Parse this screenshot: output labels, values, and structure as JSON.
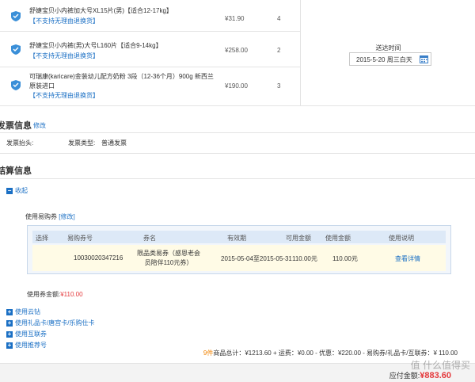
{
  "products": [
    {
      "name": "舒婕宝贝小内裤加大号XL15片(男)【适合12-17kg】",
      "tag": "【不支持无理由退换货】",
      "price": "¥31.90",
      "qty": "4"
    },
    {
      "name": "舒婕宝贝小内裤(男)大号L160片【适合9-14kg】",
      "tag": "【不支持无理由退换货】",
      "price": "¥258.00",
      "qty": "2"
    },
    {
      "name": "可瑞康(karicare)金装幼儿配方奶粉 3段（12-36个月）900g 新西兰原装进口",
      "tag": "【不支持无理由退换货】",
      "price": "¥190.00",
      "qty": "3"
    }
  ],
  "delivery": {
    "label": "送达时间",
    "date": "2015-5-20 周三白天"
  },
  "invoice": {
    "title": "发票信息",
    "edit": "修改",
    "header_label": "发票抬头:",
    "type_label": "发票类型:",
    "type_value": "普通发票"
  },
  "settlement": {
    "title": "结算信息",
    "collapse": "收起"
  },
  "coupon": {
    "title": "使用易购券",
    "edit": "[修改]",
    "headers": [
      "选择",
      "易购券号",
      "券名",
      "有效期",
      "可用金额",
      "使用金额",
      "使用说明"
    ],
    "row": {
      "code": "10030020347216",
      "name": "限品类易券（感恩老会员陪伴110元券）",
      "validity": "2015-05-04至2015-05-31",
      "available": "110.00元",
      "used": "110.00元",
      "detail": "查看详情"
    }
  },
  "used_amount": {
    "label": "使用券金额:",
    "value": "¥110.00"
  },
  "more_options": [
    "使用云钻",
    "使用礼品卡/唐宫卡/乐购仕卡",
    "使用互联券",
    "使用推荐号"
  ],
  "summary": {
    "count": "9件",
    "text": "商品总计：¥1213.60 + 运费：¥0.00 - 优惠：¥220.00 - 易购券/礼品卡/互联券：¥ 110.00"
  },
  "total": {
    "label": "应付金额:",
    "value": "¥883.60"
  },
  "watermark": "值 什么值得买"
}
